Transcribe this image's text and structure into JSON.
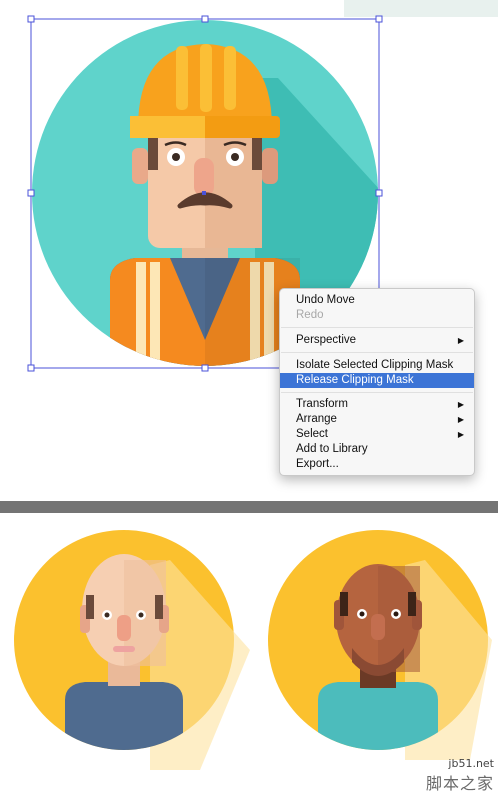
{
  "context_menu": {
    "items": [
      {
        "label": "Undo Move",
        "enabled": true,
        "submenu": false,
        "selected": false
      },
      {
        "label": "Redo",
        "enabled": false,
        "submenu": false,
        "selected": false
      },
      {
        "label": "Perspective",
        "enabled": true,
        "submenu": true,
        "selected": false
      },
      {
        "label": "Isolate Selected Clipping Mask",
        "enabled": true,
        "submenu": false,
        "selected": false
      },
      {
        "label": "Release Clipping Mask",
        "enabled": true,
        "submenu": false,
        "selected": true
      },
      {
        "label": "Transform",
        "enabled": true,
        "submenu": true,
        "selected": false
      },
      {
        "label": "Arrange",
        "enabled": true,
        "submenu": true,
        "selected": false
      },
      {
        "label": "Select",
        "enabled": true,
        "submenu": true,
        "selected": false
      },
      {
        "label": "Add to Library",
        "enabled": true,
        "submenu": false,
        "selected": false
      },
      {
        "label": "Export...",
        "enabled": true,
        "submenu": false,
        "selected": false
      }
    ],
    "submenu_arrow": "▶"
  },
  "watermark": {
    "url": "jb51.net",
    "site_name": "脚本之家"
  },
  "colors": {
    "teal_circle": "#5fd3cb",
    "yellow_circle": "#fbc12e",
    "hard_hat": "#f8a21d",
    "selection": "#3c74d6",
    "vest_orange": "#f58a1f",
    "shirt_blue": "#4f6b8f",
    "shirt_teal": "#4cbcbc"
  },
  "icons": [
    "worker-avatar-icon",
    "bald-man-avatar-icon",
    "dark-skin-man-avatar-icon",
    "submenu-arrow-icon"
  ]
}
